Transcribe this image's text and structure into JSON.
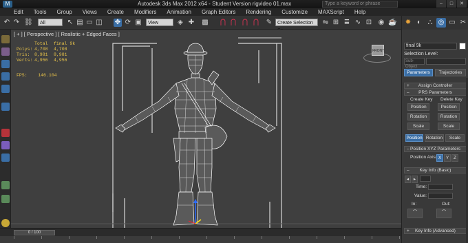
{
  "window": {
    "title": "Autodesk 3ds Max  2012 x64   - Student Version   rigvideo 01.max",
    "search_placeholder": "Type a keyword or phrase",
    "controls": [
      "–",
      "□",
      "✕"
    ]
  },
  "menu": [
    "Edit",
    "Tools",
    "Group",
    "Views",
    "Create",
    "Modifiers",
    "Animation",
    "Graph Editors",
    "Rendering",
    "Customize",
    "MAXScript",
    "Help"
  ],
  "toolbar": {
    "selection_filter": "All",
    "reference_coord": "View",
    "named_selection": "Create Selection Se"
  },
  "viewport": {
    "label": "[ + ] [ Perspective ] [ Realistic + Edged Faces ]",
    "stats": {
      "headers": [
        "Total",
        "final 9k"
      ],
      "rows": [
        {
          "label": "Polys:",
          "total": "4,708",
          "sel": "4,708"
        },
        {
          "label": "Tris:",
          "total": "8,981",
          "sel": "8,981"
        },
        {
          "label": "Verts:",
          "total": "4,956",
          "sel": "4,956"
        }
      ],
      "fps_label": "FPS:",
      "fps_value": "146.104"
    },
    "viewcube_label": "FRONT"
  },
  "command_panel": {
    "object_name": "final 9k",
    "selection_level_label": "Selection Level:",
    "subobject_label": "Sub-Object",
    "tabs": {
      "parameters": "Parameters",
      "trajectories": "Trajectories"
    },
    "assign_controller": "Assign Controller",
    "prs_title": "PRS Parameters",
    "create_key": "Create Key",
    "delete_key": "Delete Key",
    "position": "Position",
    "rotation": "Rotation",
    "scale": "Scale",
    "position_xyz_title": "Position XYZ Parameters",
    "position_axis_label": "Position Axis:",
    "axes": [
      "X",
      "Y",
      "Z"
    ],
    "key_info_basic": "Key Info (Basic)",
    "time_label": "Time:",
    "value_label": "Value:",
    "in_label": "In:",
    "out_label": "Out:",
    "key_info_advanced": "Key Info (Advanced)"
  },
  "timeline": {
    "slider_text": "0 / 100"
  }
}
